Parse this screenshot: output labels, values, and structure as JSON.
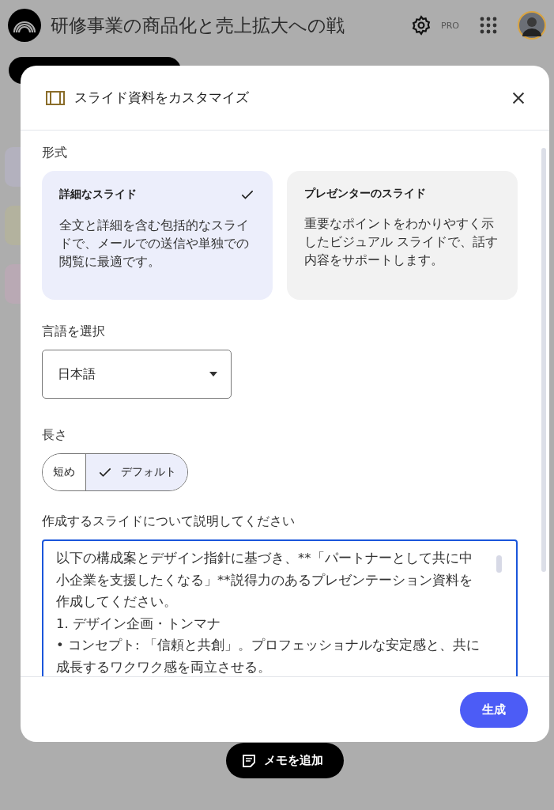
{
  "app_bar": {
    "title": "研修事業の商品化と売上拡大への戦",
    "badge": "PRO"
  },
  "dialog": {
    "title": "スライド資料をカスタマイズ",
    "format": {
      "label": "形式",
      "options": [
        {
          "title": "詳細なスライド",
          "description": "全文と詳細を含む包括的なスライドで、メールでの送信や単独での閲覧に最適です。",
          "selected": true
        },
        {
          "title": "プレゼンターのスライド",
          "description": "重要なポイントをわかりやすく示したビジュアル スライドで、話す内容をサポートします。",
          "selected": false
        }
      ]
    },
    "language": {
      "label": "言語を選択",
      "value": "日本語"
    },
    "length": {
      "label": "長さ",
      "options": [
        {
          "label": "短め",
          "selected": false
        },
        {
          "label": "デフォルト",
          "selected": true
        }
      ]
    },
    "description": {
      "label": "作成するスライドについて説明してください",
      "value": "以下の構成案とデザイン指針に基づき、**「パートナーとして共に中小企業を支援したくなる」**説得力のあるプレゼンテーション資料を作成してください。\n1. デザイン企画・トンマナ\n• コンセプト: 「信頼と共創」。プロフェッショナルな安定感と、共に成長するワクワク感を両立させる。"
    },
    "submit": "生成"
  },
  "add_note": "メモを追加"
}
